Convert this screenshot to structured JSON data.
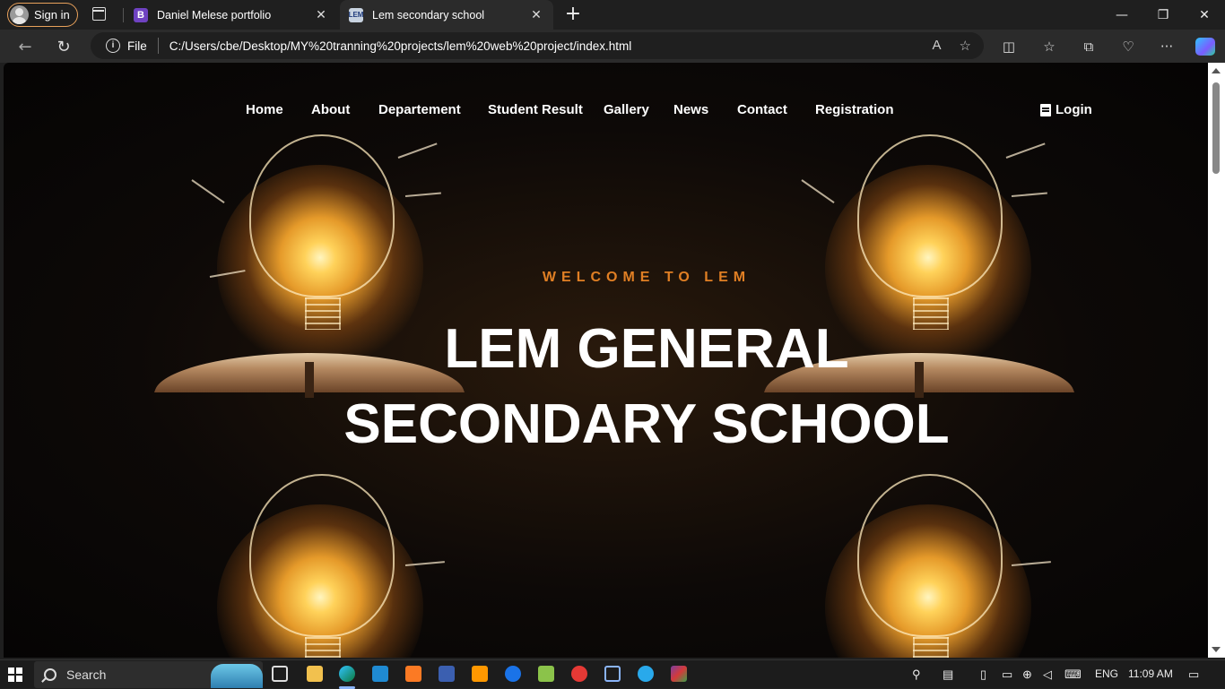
{
  "browser": {
    "signin_label": "Sign in",
    "tabs": [
      {
        "favicon_letter": "B",
        "title": "Daniel Melese portfolio",
        "active": false
      },
      {
        "favicon_letter": "LEM",
        "title": "Lem secondary school",
        "active": true
      }
    ],
    "close_glyph": "✕",
    "newtab_glyph": "+",
    "window_controls": {
      "minimize": "—",
      "restore": "❐",
      "close": "✕"
    },
    "back_glyph": "←",
    "refresh_glyph": "↻",
    "address": {
      "scheme_label": "File",
      "url": "C:/Users/cbe/Desktop/MY%20tranning%20projects/lem%20web%20project/index.html",
      "info_glyph": "i",
      "read_aloud_glyph": "A",
      "favorite_glyph": "☆"
    },
    "toolbar_icons": {
      "split_screen": "◫",
      "favorites": "☆",
      "collections": "⧉",
      "performance": "♡",
      "more": "···"
    }
  },
  "site": {
    "nav": [
      {
        "label": "Home"
      },
      {
        "label": "About"
      },
      {
        "label": "Departement"
      },
      {
        "label": "Student Result"
      },
      {
        "label": "Gallery"
      },
      {
        "label": "News"
      },
      {
        "label": "Contact"
      },
      {
        "label": "Registration"
      }
    ],
    "login_label": "Login",
    "welcome": "WELCOME TO LEM",
    "hero_line1": "LEM GENERAL",
    "hero_line2": "SECONDARY SCHOOL",
    "accent_color": "#e07f24"
  },
  "taskbar": {
    "search_placeholder": "Search",
    "apps": [
      "task-view",
      "file-explorer",
      "edge",
      "vscode",
      "xampp",
      "app-6",
      "sublime",
      "app-8",
      "notepad",
      "app-10",
      "app-11",
      "telegram",
      "winrar"
    ],
    "language": "ENG",
    "time": "11:09 AM"
  }
}
